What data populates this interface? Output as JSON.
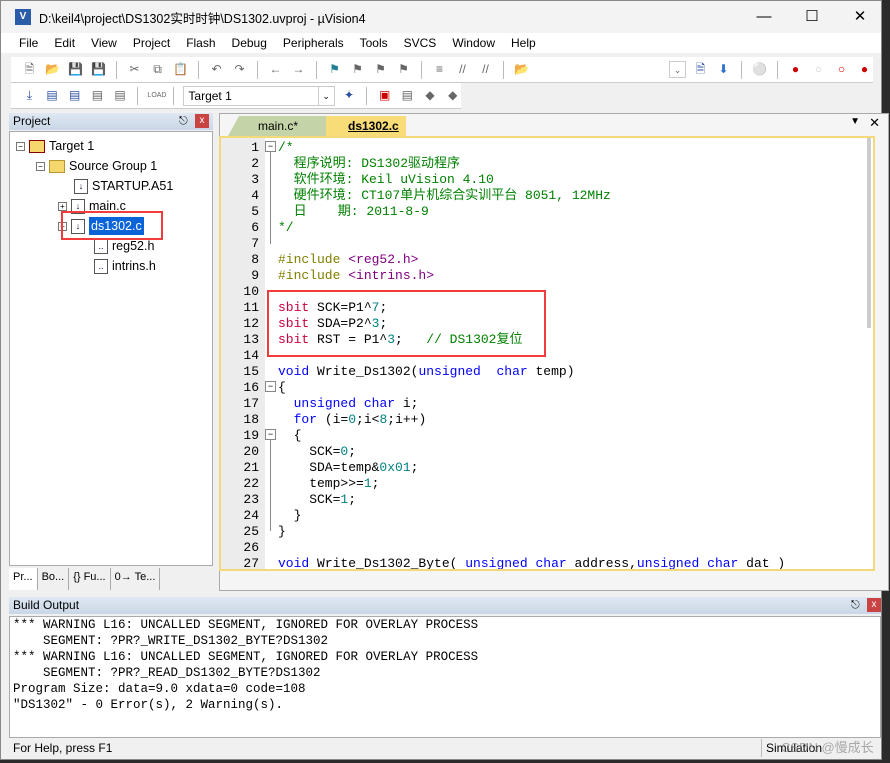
{
  "window": {
    "title": "D:\\keil4\\project\\DS1302实时时钟\\DS1302.uvproj - µVision4",
    "icon": "uv4-app-icon"
  },
  "menu": [
    "File",
    "Edit",
    "View",
    "Project",
    "Flash",
    "Debug",
    "Peripherals",
    "Tools",
    "SVCS",
    "Window",
    "Help"
  ],
  "toolbar": {
    "target": "Target 1",
    "load": "LOAD"
  },
  "project": {
    "title": "Project",
    "tree": [
      {
        "label": "Target 1"
      },
      {
        "label": "Source Group 1"
      },
      {
        "label": "STARTUP.A51"
      },
      {
        "label": "main.c"
      },
      {
        "label": "ds1302.c"
      },
      {
        "label": "reg52.h"
      },
      {
        "label": "intrins.h"
      }
    ],
    "tabs": [
      "Pr...",
      "Bo...",
      "{} Fu...",
      "0→ Te..."
    ]
  },
  "editor": {
    "tabs": [
      {
        "label": "main.c*",
        "active": false
      },
      {
        "label": "ds1302.c",
        "active": true
      }
    ],
    "lines": [
      [
        [
          "/*",
          "c"
        ]
      ],
      [
        [
          "  程序说明: DS1302驱动程序",
          "c"
        ]
      ],
      [
        [
          "  软件环境: Keil uVision 4.10",
          "c"
        ]
      ],
      [
        [
          "  硬件环境: CT107单片机综合实训平台 8051, 12MHz",
          "c"
        ]
      ],
      [
        [
          "  日    期: 2011-8-9",
          "c"
        ]
      ],
      [
        [
          "*/",
          "c"
        ]
      ],
      [],
      [
        [
          "#include ",
          "p"
        ],
        [
          "<reg52.h>",
          "h"
        ]
      ],
      [
        [
          "#include ",
          "p"
        ],
        [
          "<intrins.h>",
          "h"
        ]
      ],
      [],
      [
        [
          "sbit",
          "s"
        ],
        [
          " SCK=P1^",
          "t"
        ],
        [
          "7",
          "n"
        ],
        [
          ";",
          "t"
        ]
      ],
      [
        [
          "sbit",
          "s"
        ],
        [
          " SDA=P2^",
          "t"
        ],
        [
          "3",
          "n"
        ],
        [
          ";",
          "t"
        ]
      ],
      [
        [
          "sbit",
          "s"
        ],
        [
          " RST = P1^",
          "t"
        ],
        [
          "3",
          "n"
        ],
        [
          ";   ",
          "t"
        ],
        [
          "// DS1302复位",
          "c"
        ]
      ],
      [],
      [
        [
          "void",
          "k"
        ],
        [
          " Write_Ds1302(",
          "t"
        ],
        [
          "unsigned",
          "k"
        ],
        [
          "  ",
          "t"
        ],
        [
          "char",
          "k"
        ],
        [
          " temp)",
          "t"
        ]
      ],
      [
        [
          "{",
          "t"
        ]
      ],
      [
        [
          "  ",
          "t"
        ],
        [
          "unsigned",
          "k"
        ],
        [
          " ",
          "t"
        ],
        [
          "char",
          "k"
        ],
        [
          " i;",
          "t"
        ]
      ],
      [
        [
          "  ",
          "t"
        ],
        [
          "for",
          "k"
        ],
        [
          " (i=",
          "t"
        ],
        [
          "0",
          "n"
        ],
        [
          ";i<",
          "t"
        ],
        [
          "8",
          "n"
        ],
        [
          ";i++)",
          "t"
        ]
      ],
      [
        [
          "  {",
          "t"
        ]
      ],
      [
        [
          "    SCK=",
          "t"
        ],
        [
          "0",
          "n"
        ],
        [
          ";",
          "t"
        ]
      ],
      [
        [
          "    SDA=temp&",
          "t"
        ],
        [
          "0x01",
          "n"
        ],
        [
          ";",
          "t"
        ]
      ],
      [
        [
          "    temp>>=",
          "t"
        ],
        [
          "1",
          "n"
        ],
        [
          ";",
          "t"
        ]
      ],
      [
        [
          "    SCK=",
          "t"
        ],
        [
          "1",
          "n"
        ],
        [
          ";",
          "t"
        ]
      ],
      [
        [
          "  }",
          "t"
        ]
      ],
      [
        [
          "}",
          "t"
        ]
      ],
      [],
      [
        [
          "void",
          "k"
        ],
        [
          " Write_Ds1302_Byte( ",
          "t"
        ],
        [
          "unsigned",
          "k"
        ],
        [
          " ",
          "t"
        ],
        [
          "char",
          "k"
        ],
        [
          " address,",
          "t"
        ],
        [
          "unsigned",
          "k"
        ],
        [
          " ",
          "t"
        ],
        [
          "char",
          "k"
        ],
        [
          " dat )",
          "t"
        ]
      ]
    ]
  },
  "build": {
    "title": "Build Output",
    "lines": [
      "*** WARNING L16: UNCALLED SEGMENT, IGNORED FOR OVERLAY PROCESS",
      "    SEGMENT: ?PR?_WRITE_DS1302_BYTE?DS1302",
      "*** WARNING L16: UNCALLED SEGMENT, IGNORED FOR OVERLAY PROCESS",
      "    SEGMENT: ?PR?_READ_DS1302_BYTE?DS1302",
      "Program Size: data=9.0 xdata=0 code=108",
      "\"DS1302\" - 0 Error(s), 2 Warning(s)."
    ]
  },
  "status": {
    "help": "For Help, press F1",
    "mode": "Simulation",
    "watermark": "CSDN @慢成长"
  },
  "colors": {
    "highlight": "#f03c3c",
    "selection": "#0a64d8",
    "comment": "#008000",
    "keyword": "#0000ff"
  }
}
